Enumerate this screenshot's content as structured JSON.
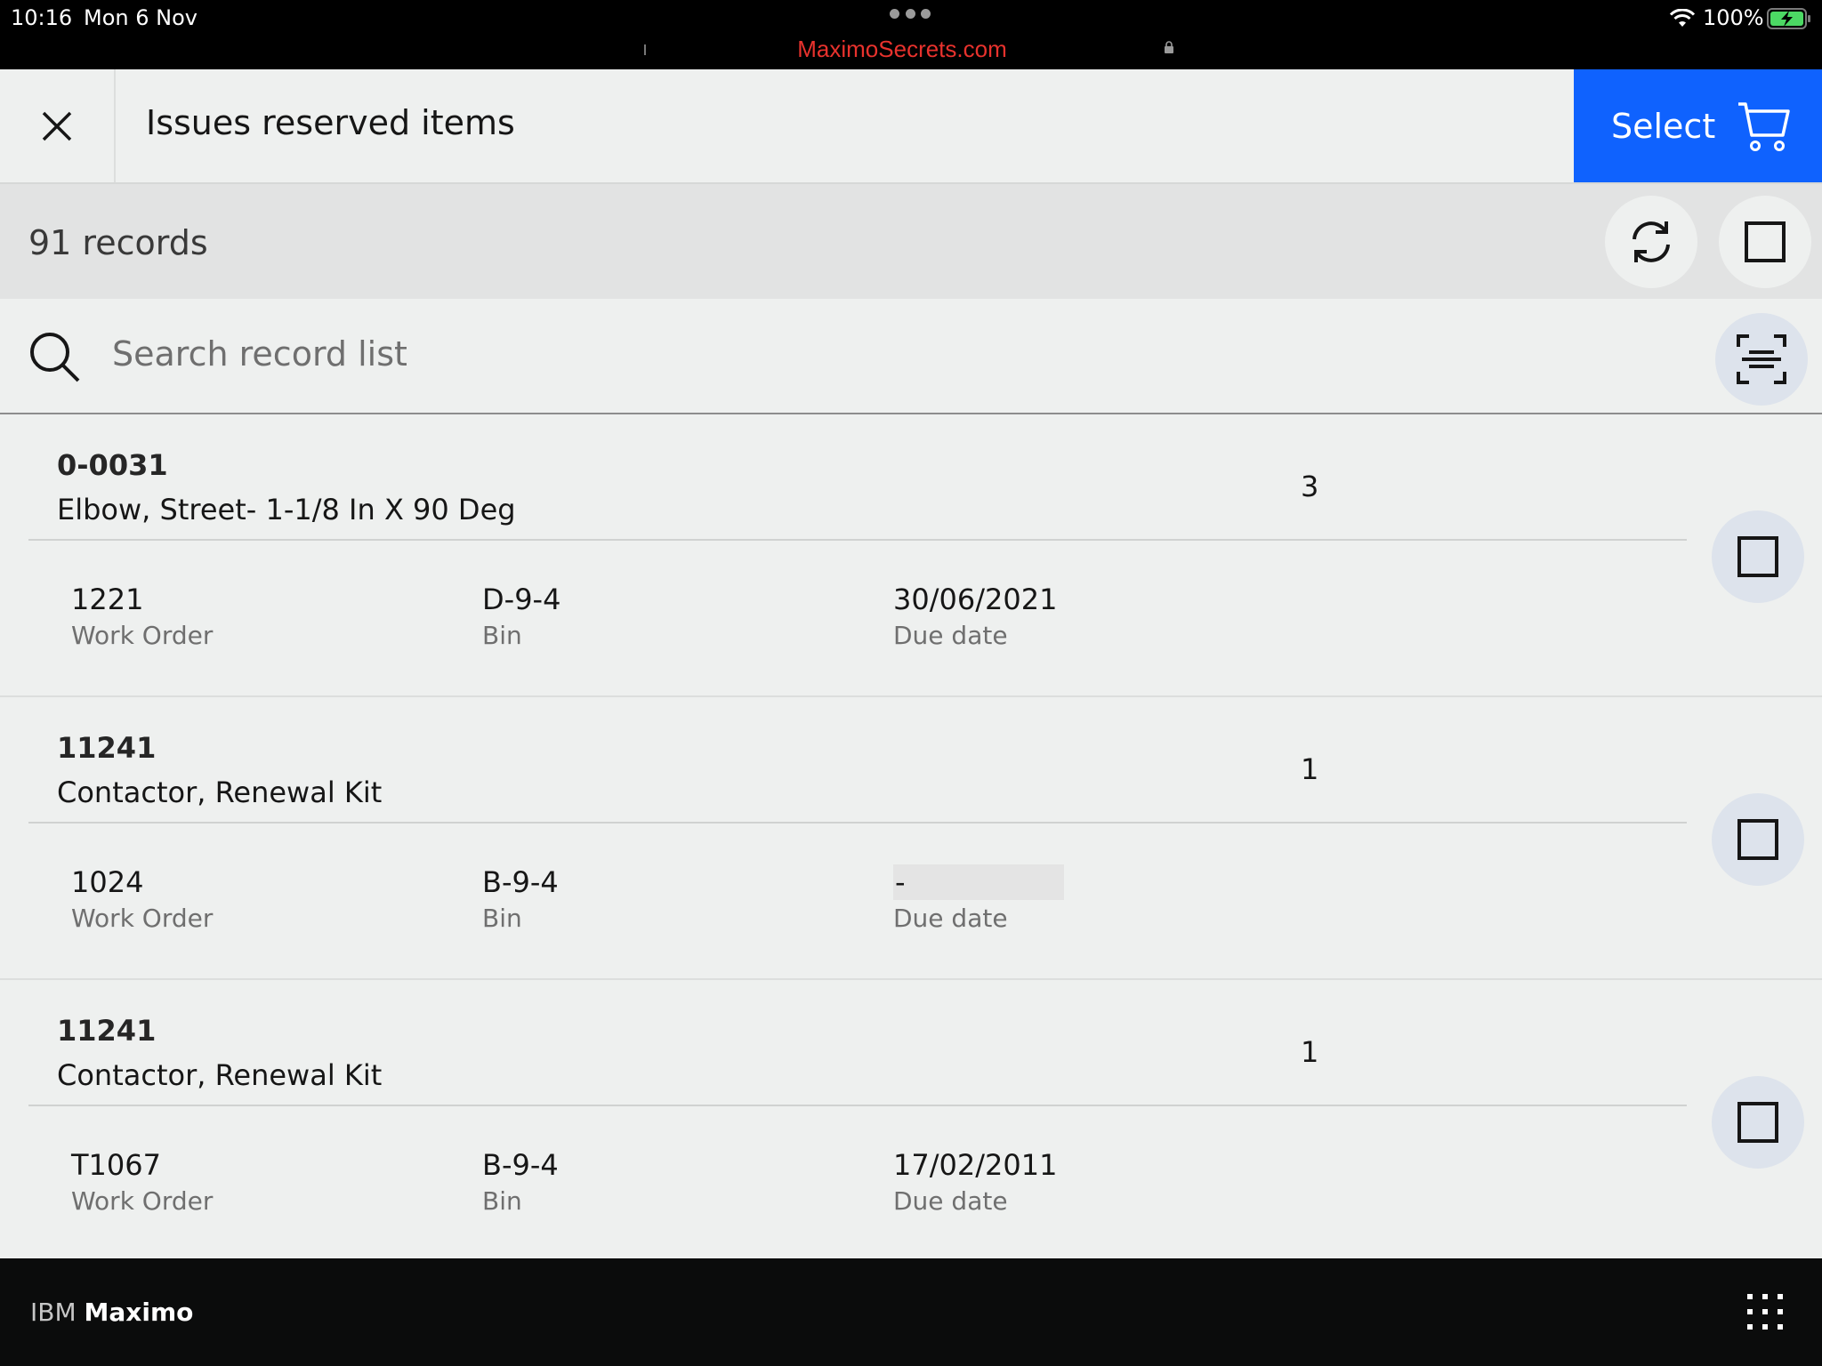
{
  "status_bar": {
    "time": "10:16",
    "date": "Mon 6 Nov",
    "url": "MaximoSecrets.com",
    "battery": "100%"
  },
  "header": {
    "title": "Issues reserved items",
    "select_label": "Select",
    "accent_color": "#0f62fe"
  },
  "toolbar": {
    "records_count": "91 records"
  },
  "search": {
    "placeholder": "Search record list",
    "value": ""
  },
  "records": [
    {
      "item": "0-0031",
      "description": "Elbow, Street- 1-1/8 In X 90 Deg",
      "quantity": "3",
      "work_order": "1221",
      "work_order_label": "Work Order",
      "bin": "D-9-4",
      "bin_label": "Bin",
      "due_date": "30/06/2021",
      "due_date_label": "Due date"
    },
    {
      "item": "11241",
      "description": "Contactor, Renewal Kit",
      "quantity": "1",
      "work_order": "1024",
      "work_order_label": "Work Order",
      "bin": "B-9-4",
      "bin_label": "Bin",
      "due_date": "-",
      "due_date_label": "Due date"
    },
    {
      "item": "11241",
      "description": "Contactor, Renewal Kit",
      "quantity": "1",
      "work_order": "T1067",
      "work_order_label": "Work Order",
      "bin": "B-9-4",
      "bin_label": "Bin",
      "due_date": "17/02/2011",
      "due_date_label": "Due date"
    }
  ],
  "footer": {
    "brand_prefix": "IBM",
    "brand_name": "Maximo"
  }
}
